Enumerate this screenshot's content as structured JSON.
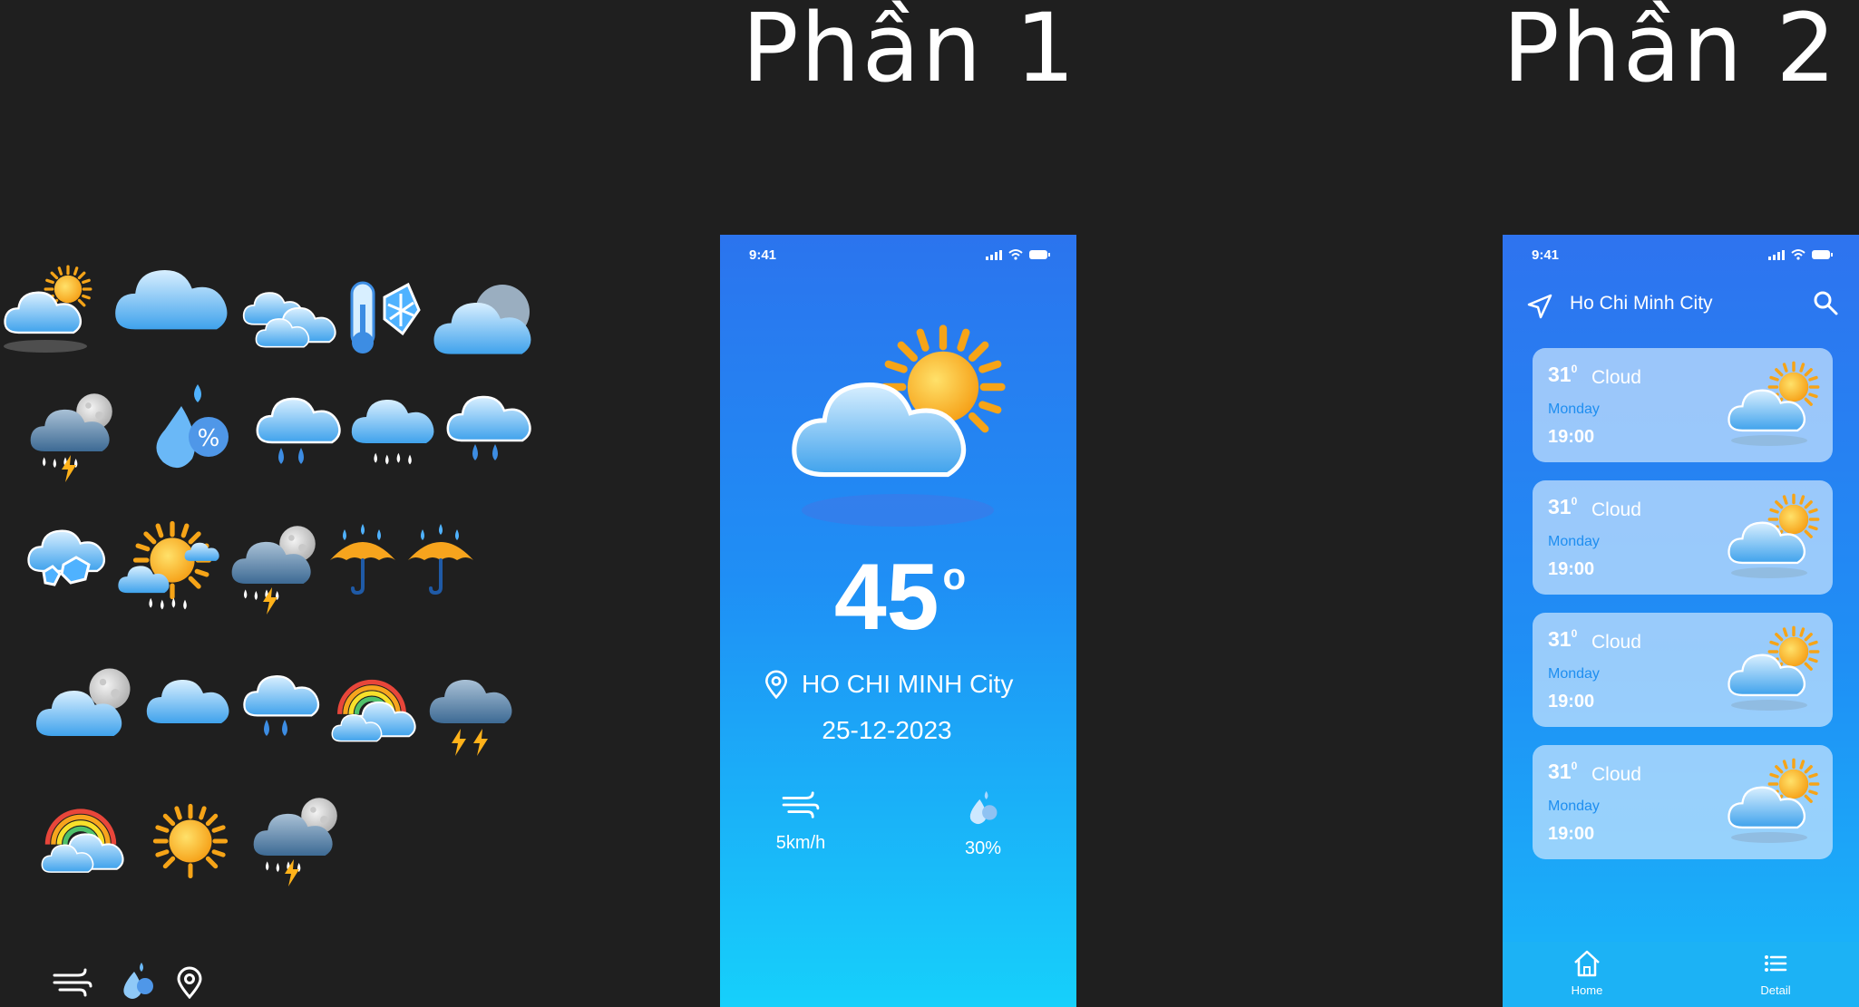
{
  "sections": {
    "part1_title": "Phần 1",
    "part2_title": "Phần 2"
  },
  "icon_set": [
    "partly-sunny-icon",
    "cloud-icon",
    "double-cloud-icon",
    "cold-thermometer-icon",
    "cloud-moon-icon",
    "thunderstorm-moon-icon",
    "humidity-drop-icon",
    "rain-cloud-icon",
    "drizzle-cloud-icon",
    "heavy-rain-cloud-icon",
    "snow-cloud-icon",
    "sun-rain-icon",
    "storm-moon-icon",
    "rain-umbrella-icon",
    "rain-umbrella-icon",
    "cloudy-moon-icon",
    "cloud-icon",
    "rain-cloud-icon",
    "rainbow-cloud-icon",
    "dark-thunder-cloud-icon",
    "rainbow-icon",
    "sun-icon",
    "storm-moon-icon",
    "wind-icon",
    "humidity-icon",
    "location-pin-icon"
  ],
  "phone1": {
    "status_time": "9:41",
    "temperature": "45",
    "degree": "o",
    "location": "HO CHI MINH City",
    "date": "25-12-2023",
    "wind": {
      "icon": "wind-icon",
      "value": "5km/h"
    },
    "humidity": {
      "icon": "humidity-icon",
      "value": "30%"
    }
  },
  "phone2": {
    "status_time": "9:41",
    "city": "Ho Chi Minh City",
    "forecast": [
      {
        "temp": "31",
        "deg": "0",
        "condition": "Cloud",
        "day": "Monday",
        "time": "19:00"
      },
      {
        "temp": "31",
        "deg": "0",
        "condition": "Cloud",
        "day": "Monday",
        "time": "19:00"
      },
      {
        "temp": "31",
        "deg": "0",
        "condition": "Cloud",
        "day": "Monday",
        "time": "19:00"
      },
      {
        "temp": "31",
        "deg": "0",
        "condition": "Cloud",
        "day": "Monday",
        "time": "19:00"
      }
    ],
    "tabs": [
      {
        "label": "Home",
        "icon": "home-icon"
      },
      {
        "label": "Detail",
        "icon": "list-icon"
      }
    ]
  },
  "colors": {
    "background": "#1f1f1f",
    "phone_gradient_top": "#2b74ee",
    "phone_gradient_bottom": "#16d0fb",
    "card_bg": "#c7e3fd",
    "accent_blue": "#1e8ef0",
    "sun_orange": "#f7a41d"
  }
}
